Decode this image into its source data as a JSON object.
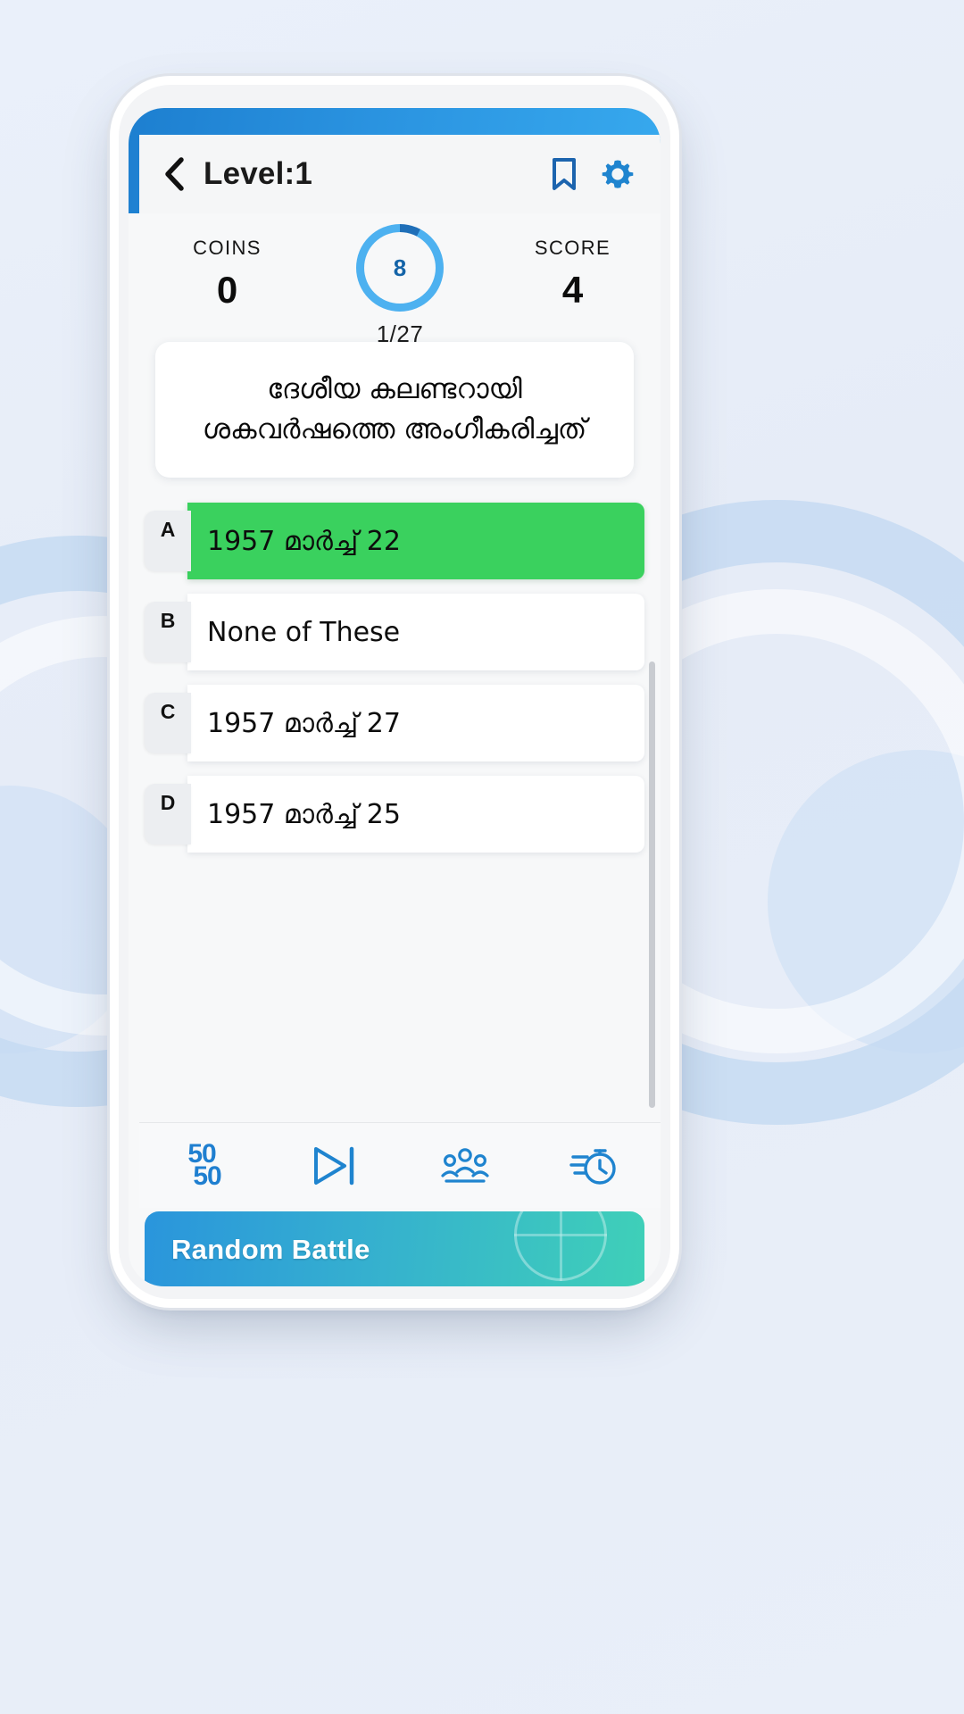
{
  "app": {
    "header": {
      "back_icon": "chevron-left-icon",
      "title": "Level:1",
      "bookmark_icon": "bookmark-icon",
      "settings_icon": "gear-icon"
    },
    "stats": {
      "coins_label": "COINS",
      "coins_value": "0",
      "timer_value": "8",
      "progress_text": "1/27",
      "score_label": "SCORE",
      "score_value": "4"
    },
    "question": {
      "text": "ദേശീയ കലണ്ടറായി ശകവർഷത്തെ അംഗീകരിച്ചത്"
    },
    "options": [
      {
        "key": "A",
        "text": "1957 മാർച്ച് 22",
        "state": "correct"
      },
      {
        "key": "B",
        "text": "None of These",
        "state": "normal"
      },
      {
        "key": "C",
        "text": "1957 മാർച്ച് 27",
        "state": "normal"
      },
      {
        "key": "D",
        "text": "1957 മാർച്ച് 25",
        "state": "normal"
      }
    ],
    "toolbar": [
      {
        "name": "fifty-fifty-lifeline",
        "top": "50",
        "bottom": "50"
      },
      {
        "name": "skip-question-button",
        "icon": "play-skip-icon"
      },
      {
        "name": "audience-poll-lifeline",
        "icon": "audience-people-icon"
      },
      {
        "name": "extra-time-lifeline",
        "icon": "stopwatch-icon"
      }
    ],
    "banner": {
      "label": "Random Battle",
      "icon": "globe-icon"
    },
    "colors": {
      "primary_blue": "#2a93e0",
      "dark_blue": "#1d7fd0",
      "correct_green": "#3ad15e",
      "timer_track": "#4db1f0",
      "timer_progress": "#1f6fb8",
      "banner_start": "#2a95dc",
      "banner_end": "#3fd0b8"
    }
  }
}
